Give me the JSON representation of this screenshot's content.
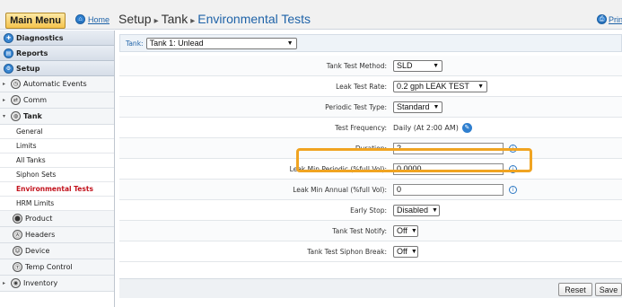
{
  "topbar": {
    "main_menu_label": "Main Menu",
    "home_label": "Home",
    "breadcrumb": [
      "Setup",
      "Tank",
      "Environmental Tests"
    ],
    "breadcrumb_separator": "▸",
    "print_label": "Prin"
  },
  "sidebar": {
    "sections": [
      {
        "label": "Diagnostics",
        "icon": "diagnostics-icon"
      },
      {
        "label": "Reports",
        "icon": "reports-icon"
      },
      {
        "label": "Setup",
        "icon": "setup-gear-icon"
      }
    ],
    "items": [
      {
        "label": "Automatic Events",
        "expandable": true,
        "icon": "automatic-events-icon"
      },
      {
        "label": "Comm",
        "expandable": true,
        "icon": "comm-icon"
      },
      {
        "label": "Tank",
        "expandable": true,
        "expanded": true,
        "icon": "tank-icon"
      }
    ],
    "tank_subitems": [
      "General",
      "Limits",
      "All Tanks",
      "Siphon Sets",
      "Environmental Tests",
      "HRM Limits"
    ],
    "selected_subitem": "Environmental Tests",
    "lower_items": [
      {
        "label": "Product",
        "icon": "product-icon"
      },
      {
        "label": "Headers",
        "icon": "headers-icon"
      },
      {
        "label": "Device",
        "icon": "device-icon"
      },
      {
        "label": "Temp Control",
        "icon": "temp-control-icon"
      },
      {
        "label": "Inventory",
        "icon": "inventory-icon",
        "expandable": true
      }
    ]
  },
  "tank_selector": {
    "label": "Tank:",
    "value": "Tank 1: Unlead"
  },
  "form": {
    "tank_test_method": {
      "label": "Tank Test Method:",
      "value": "SLD"
    },
    "leak_test_rate": {
      "label": "Leak Test Rate:",
      "value": "0.2 gph LEAK TEST"
    },
    "periodic_test_type": {
      "label": "Periodic Test Type:",
      "value": "Standard"
    },
    "test_frequency": {
      "label": "Test Frequency:",
      "value": "Daily (At 2:00 AM)"
    },
    "duration": {
      "label": "Duration:",
      "value": "2"
    },
    "leak_min_periodic": {
      "label": "Leak Min Periodic (%full Vol):",
      "value": "0.0000"
    },
    "leak_min_annual": {
      "label": "Leak Min Annual (%full Vol):",
      "value": "0"
    },
    "early_stop": {
      "label": "Early Stop:",
      "value": "Disabled"
    },
    "tank_test_notify": {
      "label": "Tank Test Notify:",
      "value": "Off"
    },
    "tank_test_siphon_break": {
      "label": "Tank Test Siphon Break:",
      "value": "Off"
    }
  },
  "buttons": {
    "reset": "Reset",
    "save": "Save"
  },
  "colors": {
    "highlight_border": "#f0a422",
    "selected_item": "#c2121c",
    "link_blue": "#1f63a8",
    "main_menu_gold": "#f5c34c"
  }
}
